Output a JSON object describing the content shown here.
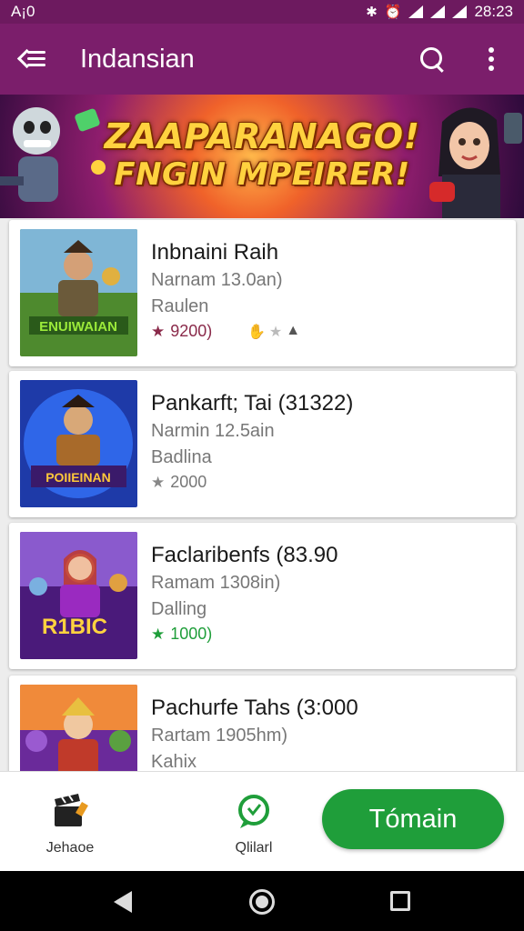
{
  "status_bar": {
    "carrier": "A¡0",
    "time": "28:23"
  },
  "app_bar": {
    "title": "Indansian"
  },
  "banner": {
    "line1": "ZAAPARANAGO!",
    "line2": "FNGIN MPEIRER!"
  },
  "cards": [
    {
      "title": "Inbnaini Raih",
      "sub1": "Narnam 13.0an)",
      "sub2": "Raulen",
      "rating": "9200)",
      "star_color": "#8a2a4a",
      "thumb_text": "ENUIWAIAN"
    },
    {
      "title": "Pankarft; Tai (31322)",
      "sub1": "Narmin 12.5ain",
      "sub2": "Badlina",
      "rating": "2000",
      "star_color": "#888888",
      "thumb_text": "POIIEINAN"
    },
    {
      "title": "Faclaribenfs (83.90",
      "sub1": "Ramam 1308in)",
      "sub2": "Dalling",
      "rating": "1000)",
      "star_color": "#1f9e3a",
      "thumb_text": "R1BIC"
    },
    {
      "title": "Pachurfe Tahs (3:000",
      "sub1": "Rartam 1905hm)",
      "sub2": "Kahix",
      "rating": "",
      "star_color": "#888888",
      "thumb_text": ""
    }
  ],
  "bottom_nav": {
    "items": [
      {
        "label": "Jehaoe",
        "icon": "clapperboard-icon"
      },
      {
        "label": "Qlilarl",
        "icon": "chat-icon"
      }
    ],
    "cta_label": "Tómain"
  },
  "colors": {
    "app_bar": "#7b1e6b",
    "accent_green": "#1f9e3a"
  }
}
